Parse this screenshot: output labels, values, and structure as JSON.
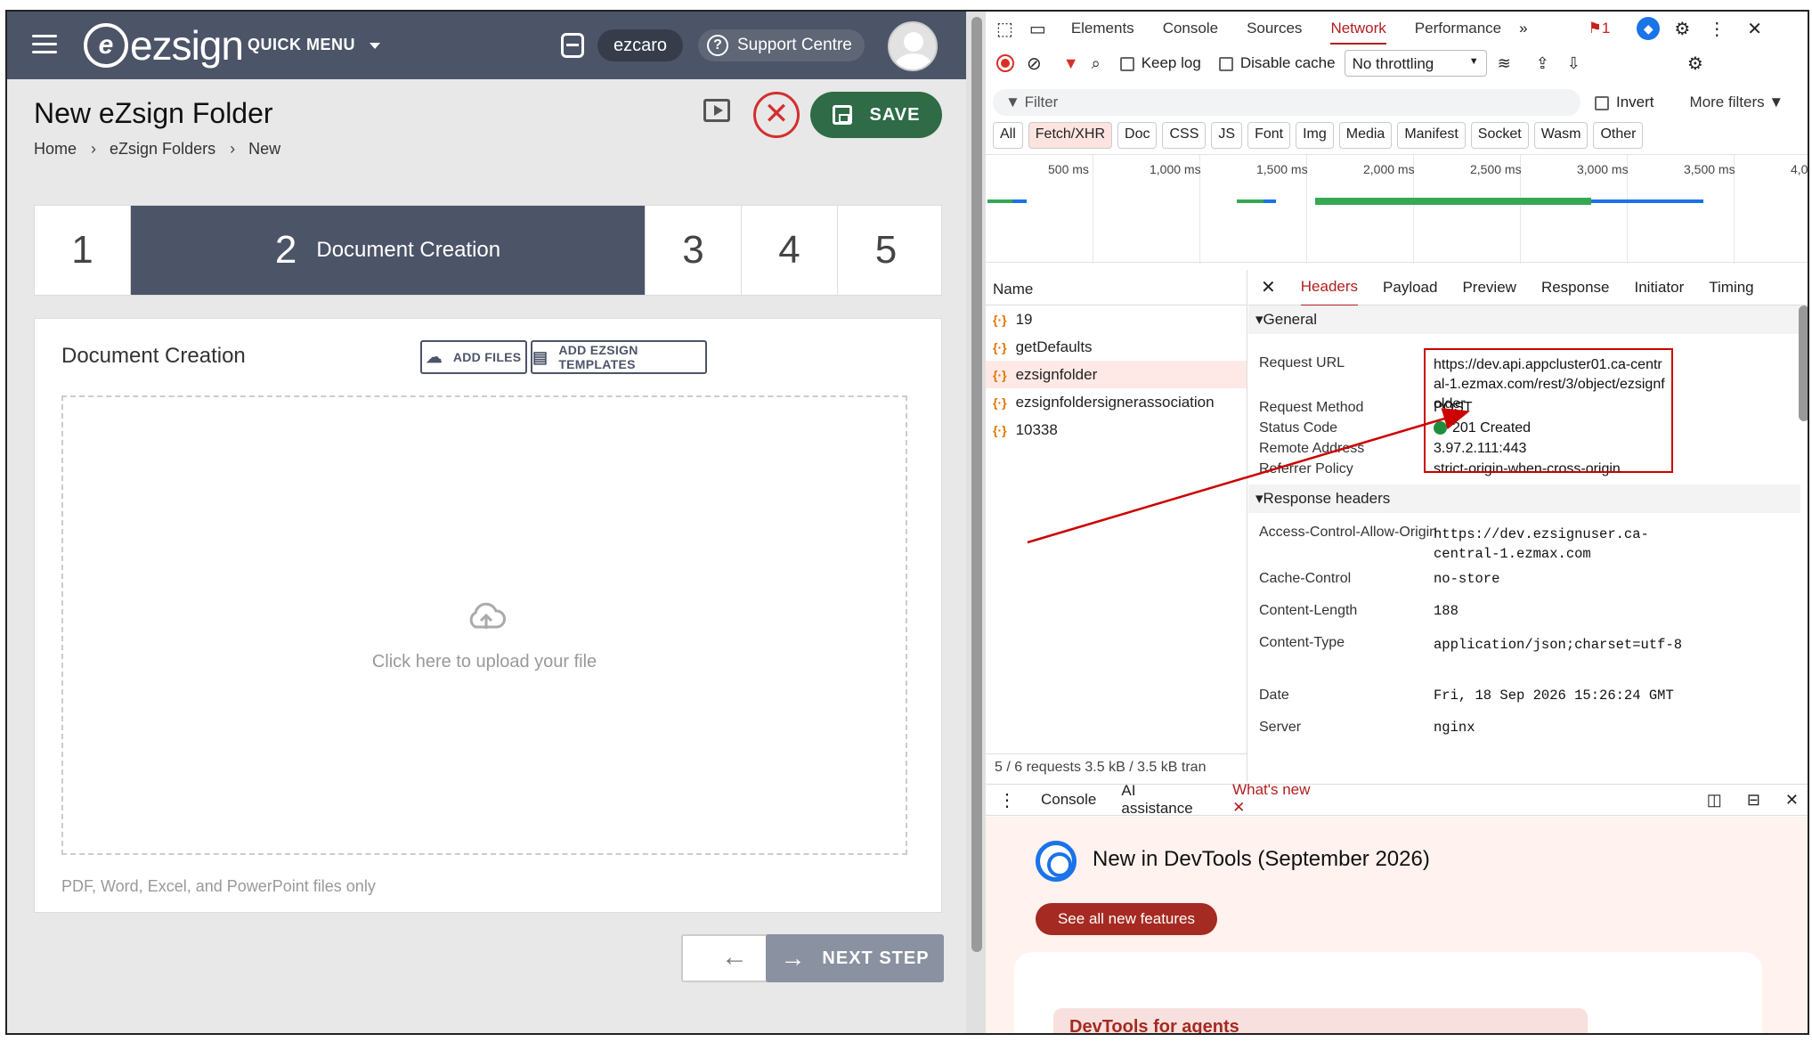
{
  "app": {
    "logo_text": "ezsign",
    "quick_menu": "QUICK MENU",
    "username": "ezcaro",
    "support": "Support Centre",
    "page_title": "New eZsign Folder",
    "breadcrumb": [
      "Home",
      "eZsign Folders",
      "New"
    ],
    "save_label": "SAVE",
    "steps": [
      {
        "num": "1",
        "label": ""
      },
      {
        "num": "2",
        "label": "Document Creation"
      },
      {
        "num": "3",
        "label": ""
      },
      {
        "num": "4",
        "label": ""
      },
      {
        "num": "5",
        "label": ""
      }
    ],
    "card_title": "Document Creation",
    "add_files": "ADD FILES",
    "add_templates": "ADD EZSIGN TEMPLATES",
    "drop_text": "Click here to upload your file",
    "hint": "PDF, Word, Excel, and PowerPoint files only",
    "next_step": "NEXT STEP",
    "colors": {
      "topbar": "#4c5468",
      "save": "#2e6b46",
      "cancel": "#d32f2f"
    }
  },
  "devtools": {
    "tabs": [
      "Elements",
      "Console",
      "Sources",
      "Network",
      "Performance"
    ],
    "selected_tab": "Network",
    "issues_count": "1",
    "keep_log": "Keep log",
    "disable_cache": "Disable cache",
    "throttling": "No throttling",
    "filter_placeholder": "Filter",
    "invert": "Invert",
    "more_filters": "More filters",
    "type_filters": [
      "All",
      "Fetch/XHR",
      "Doc",
      "CSS",
      "JS",
      "Font",
      "Img",
      "Media",
      "Manifest",
      "Socket",
      "Wasm",
      "Other"
    ],
    "timeline_ticks": [
      "500 ms",
      "1,000 ms",
      "1,500 ms",
      "2,000 ms",
      "2,500 ms",
      "3,000 ms",
      "3,500 ms",
      "4,0"
    ],
    "name_header": "Name",
    "requests": [
      "19",
      "getDefaults",
      "ezsignfolder",
      "ezsignfoldersignerassociation",
      "10338"
    ],
    "selected_request": "ezsignfolder",
    "footer": "5 / 6 requests   3.5 kB / 3.5 kB tran",
    "detail_tabs": [
      "Headers",
      "Payload",
      "Preview",
      "Response",
      "Initiator",
      "Timing"
    ],
    "general_title": "General",
    "general": [
      {
        "k": "Request URL",
        "v": "https://dev.api.appcluster01.ca-central-1.ezmax.com/rest/3/object/ezsignfolder"
      },
      {
        "k": "Request Method",
        "v": "POST"
      },
      {
        "k": "Status Code",
        "v": "201 Created"
      },
      {
        "k": "Remote Address",
        "v": "3.97.2.111:443"
      },
      {
        "k": "Referrer Policy",
        "v": "strict-origin-when-cross-origin"
      }
    ],
    "response_title": "Response headers",
    "response_headers": [
      {
        "k": "Access-Control-Allow-Origin",
        "v": "https://dev.ezsignuser.ca-central-1.ezmax.com"
      },
      {
        "k": "Cache-Control",
        "v": "no-store"
      },
      {
        "k": "Content-Length",
        "v": "188"
      },
      {
        "k": "Content-Type",
        "v": "application/json;charset=utf-8"
      },
      {
        "k": "Date",
        "v": "Fri, 18 Sep 2026 15:26:24 GMT"
      },
      {
        "k": "Server",
        "v": "nginx"
      }
    ],
    "drawer_tabs": [
      "Console",
      "AI assistance",
      "What's new"
    ],
    "whatsnew_title": "New in DevTools (September 2026)",
    "see_all": "See all new features",
    "card_link": "DevTools for agents"
  }
}
